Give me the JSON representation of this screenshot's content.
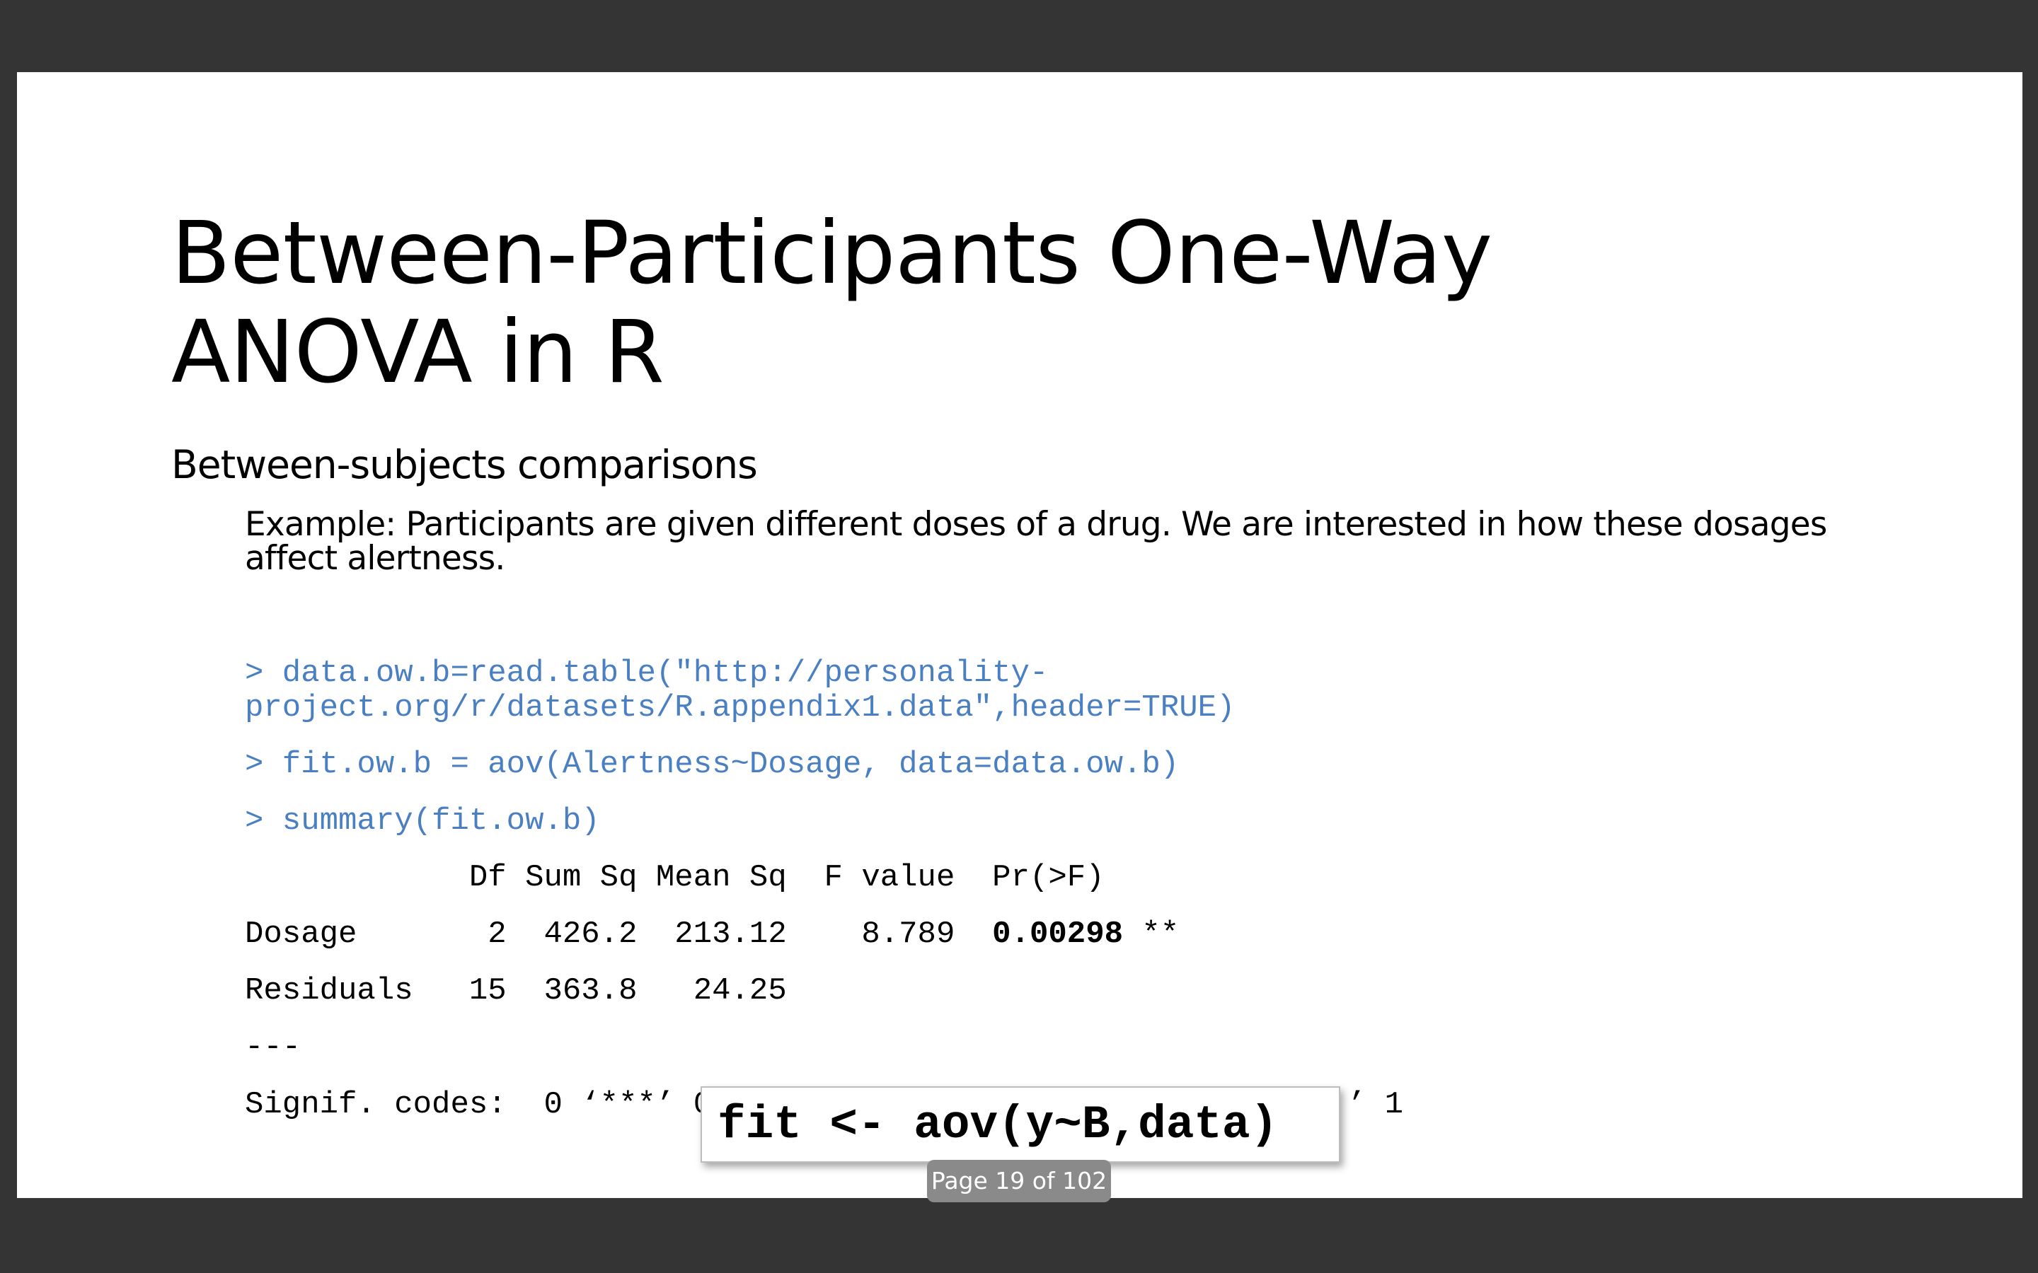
{
  "slide": {
    "title_line1": "Between-Participants One-Way",
    "title_line2": "ANOVA in R",
    "subtitle": "Between-subjects comparisons",
    "example": "Example: Participants are given different doses of a drug. We are interested in how these dosages affect alertness.",
    "code": {
      "cmd1_line1": "> data.ow.b=read.table(\"http://personality-",
      "cmd1_line2": "project.org/r/datasets/R.appendix1.data\",header=TRUE)",
      "cmd2": "> fit.ow.b = aov(Alertness~Dosage, data=data.ow.b)",
      "cmd3": "> summary(fit.ow.b)"
    },
    "anova_table": {
      "header": "            Df Sum Sq Mean Sq  F value  Pr(>F)",
      "dosage_row_prefix": "Dosage       2  426.2  213.12    8.789  ",
      "dosage_p_value": "0.00298",
      "dosage_signif": " **",
      "residuals_row": "Residuals   15  363.8   24.25",
      "separator": "---",
      "signif_codes": "Signif. codes:  0 ‘***’ 0.001 ‘**’ 0.01 ‘*’ 0.05 ‘.’ 0.1 ‘ ’ 1"
    },
    "callout": "fit <- aov(y~B,data)"
  },
  "viewer": {
    "page_indicator": "Page 19 of 102"
  },
  "colors": {
    "background": "#343434",
    "slide": "#ffffff",
    "command_text": "#4a7fc1",
    "page_indicator_bg": "#8a8a8a"
  }
}
